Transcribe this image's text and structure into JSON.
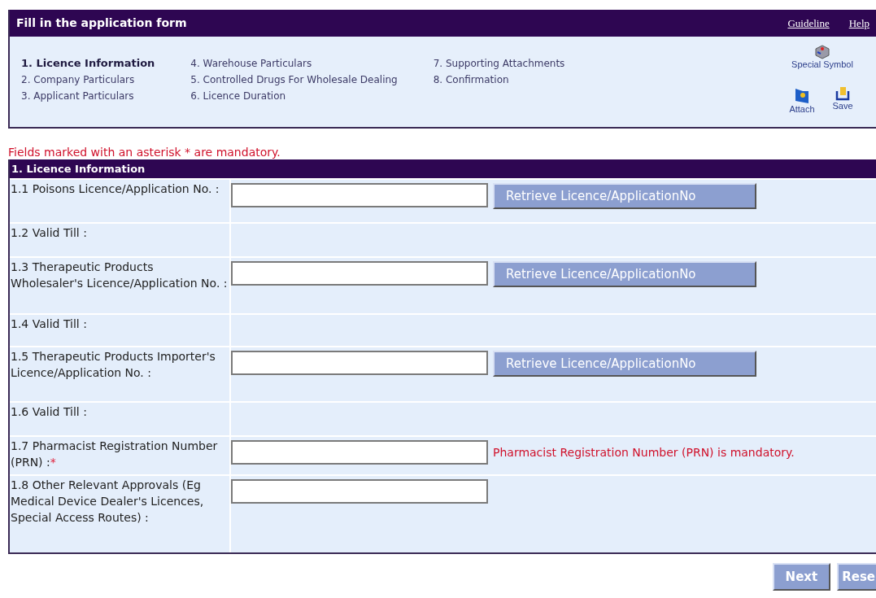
{
  "header": {
    "title": "Fill in the application form",
    "links": [
      "Guideline",
      "Help"
    ]
  },
  "steps": [
    {
      "label": "1. Licence Information",
      "selected": true
    },
    {
      "label": "2. Company Particulars",
      "selected": false
    },
    {
      "label": "3. Applicant Particulars",
      "selected": false
    },
    {
      "label": "4. Warehouse Particulars",
      "selected": false
    },
    {
      "label": "5. Controlled Drugs For Wholesale Dealing",
      "selected": false
    },
    {
      "label": "6. Licence Duration",
      "selected": false
    },
    {
      "label": "7. Supporting Attachments",
      "selected": false
    },
    {
      "label": "8. Confirmation",
      "selected": false
    }
  ],
  "tools": [
    {
      "kind": "symbol",
      "label": "Special Symbol"
    },
    {
      "kind": "attach",
      "label": "Attach"
    },
    {
      "kind": "save",
      "label": "Save"
    }
  ],
  "mandatory_note": "Fields marked with an asterisk * are mandatory.",
  "section": {
    "title": "1. Licence Information",
    "rows": [
      {
        "kind": "field",
        "label": "1.1 Poisons Licence/Application No. :",
        "button": "Retrieve Licence/ApplicationNo"
      },
      {
        "kind": "text",
        "label": "1.2 Valid Till :"
      },
      {
        "kind": "field",
        "label": "1.3 Therapeutic Products Wholesaler's Licence/Application No. :",
        "button": "Retrieve Licence/ApplicationNo"
      },
      {
        "kind": "text",
        "label": "1.4 Valid Till :"
      },
      {
        "kind": "field",
        "label": "1.5 Therapeutic Products Importer's Licence/Application No. :",
        "button": "Retrieve Licence/ApplicationNo"
      },
      {
        "kind": "text",
        "label": "1.6 Valid Till :"
      },
      {
        "kind": "field",
        "label": "1.7 Pharmacist Registration Number (PRN) :",
        "required_mark": "*",
        "error": "Pharmacist Registration Number (PRN) is mandatory."
      },
      {
        "kind": "field",
        "label": "1.8 Other Relevant Approvals (Eg Medical Device Dealer's Licences, Special Access Routes) :"
      }
    ]
  },
  "footer_buttons": [
    "Next",
    "Rese"
  ]
}
